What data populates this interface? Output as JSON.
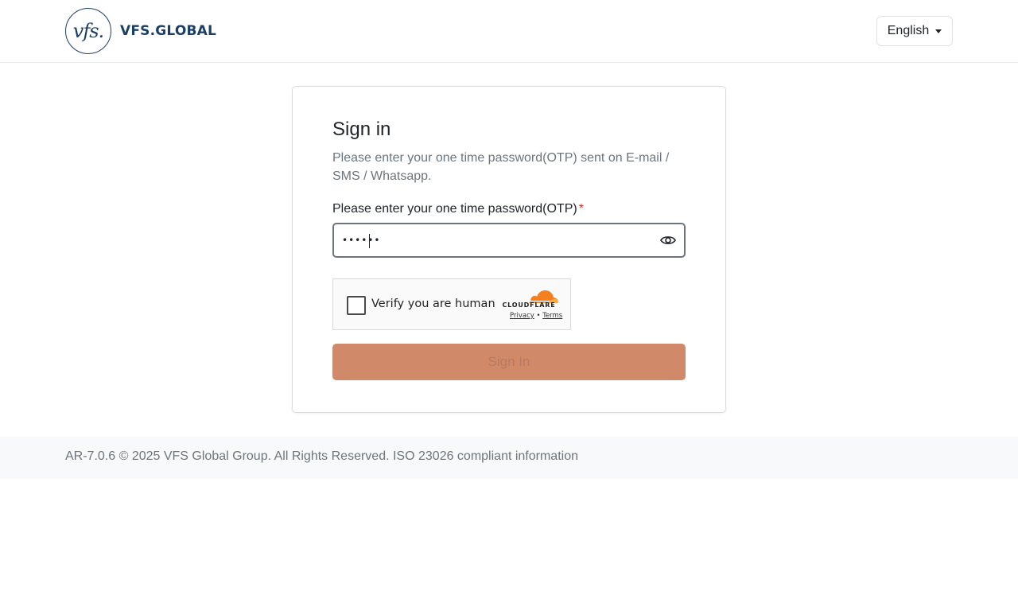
{
  "header": {
    "logo_mark": "vfs.",
    "logo_text": "VFS.GLOBAL",
    "language": "English"
  },
  "signin": {
    "title": "Sign in",
    "subtitle": "Please enter your one time password(OTP) sent on E-mail / SMS / Whatsapp.",
    "otp_label": "Please enter your one time password(OTP)",
    "required_mark": "*",
    "otp_value": "••••••",
    "button_label": "Sign In"
  },
  "captcha": {
    "label": "Verify you are human",
    "provider": "CLOUDFLARE",
    "privacy": "Privacy",
    "separator": "•",
    "terms": "Terms"
  },
  "footer": {
    "text": "AR-7.0.6 © 2025 VFS Global Group. All Rights Reserved. ISO 23026 compliant information"
  },
  "colors": {
    "brand": "#1c3f66",
    "button": "#d08969",
    "cloudflare_orange": "#f48120"
  },
  "icons": {
    "password_toggle": "eye-icon",
    "dropdown": "caret-down-icon"
  }
}
